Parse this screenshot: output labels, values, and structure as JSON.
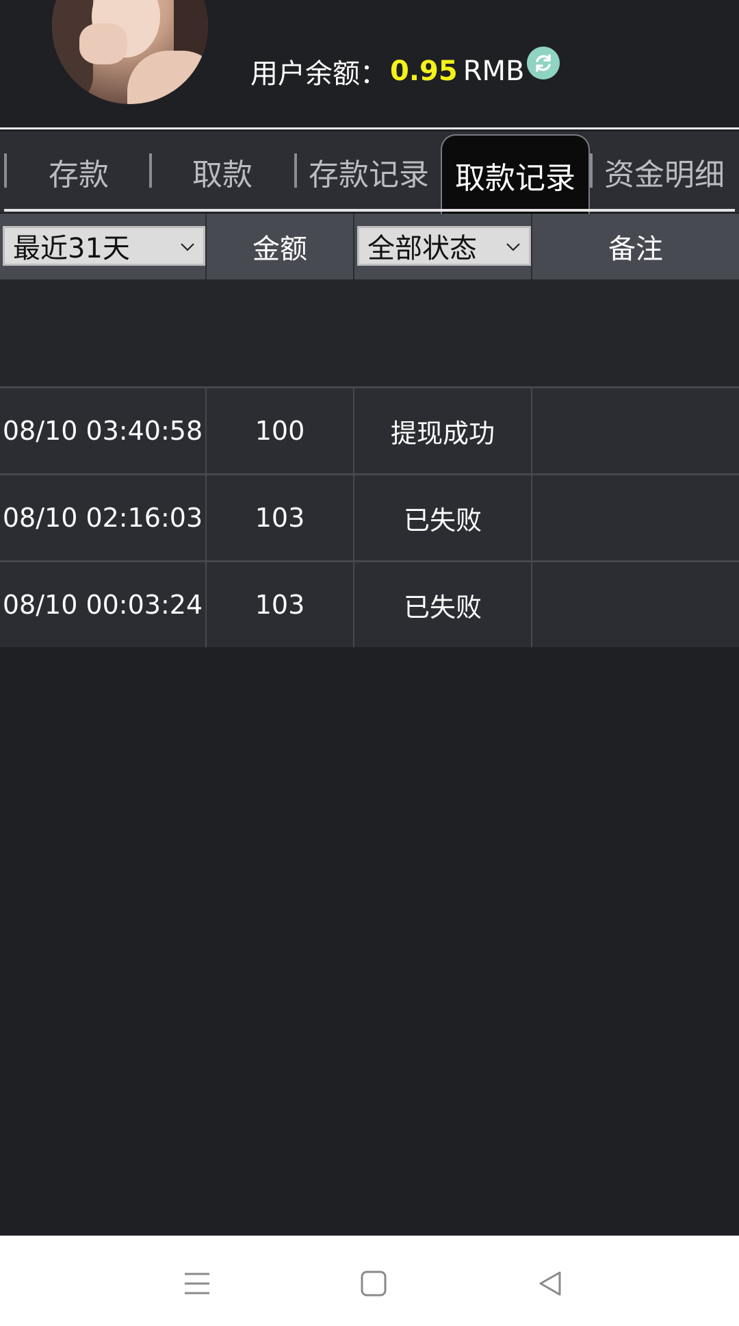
{
  "header": {
    "balance_label": "用户余额：",
    "balance_amount": "0.95",
    "balance_currency": "RMB"
  },
  "tabs": [
    {
      "label": "存款",
      "active": false
    },
    {
      "label": "取款",
      "active": false
    },
    {
      "label": "存款记录",
      "active": false
    },
    {
      "label": "取款记录",
      "active": true
    },
    {
      "label": "资金明细",
      "active": false
    }
  ],
  "table": {
    "date_filter": "最近31天",
    "amount_header": "金额",
    "status_filter": "全部状态",
    "remark_header": "备注",
    "rows": [
      {
        "time": "08/10 03:40:58",
        "amount": "100",
        "status": "提现成功",
        "remark": ""
      },
      {
        "time": "08/10 02:16:03",
        "amount": "103",
        "status": "已失败",
        "remark": ""
      },
      {
        "time": "08/10 00:03:24",
        "amount": "103",
        "status": "已失败",
        "remark": ""
      }
    ]
  },
  "colors": {
    "background": "#1f2024",
    "balance_amount": "#f5f21a",
    "active_tab": "#0b0b0c",
    "refresh_icon": "#8fd3c3"
  },
  "icons": {
    "refresh": "refresh-icon",
    "dropdown": "chevron-down-icon",
    "nav_menu": "menu-icon",
    "nav_home": "home-icon",
    "nav_back": "back-icon"
  }
}
